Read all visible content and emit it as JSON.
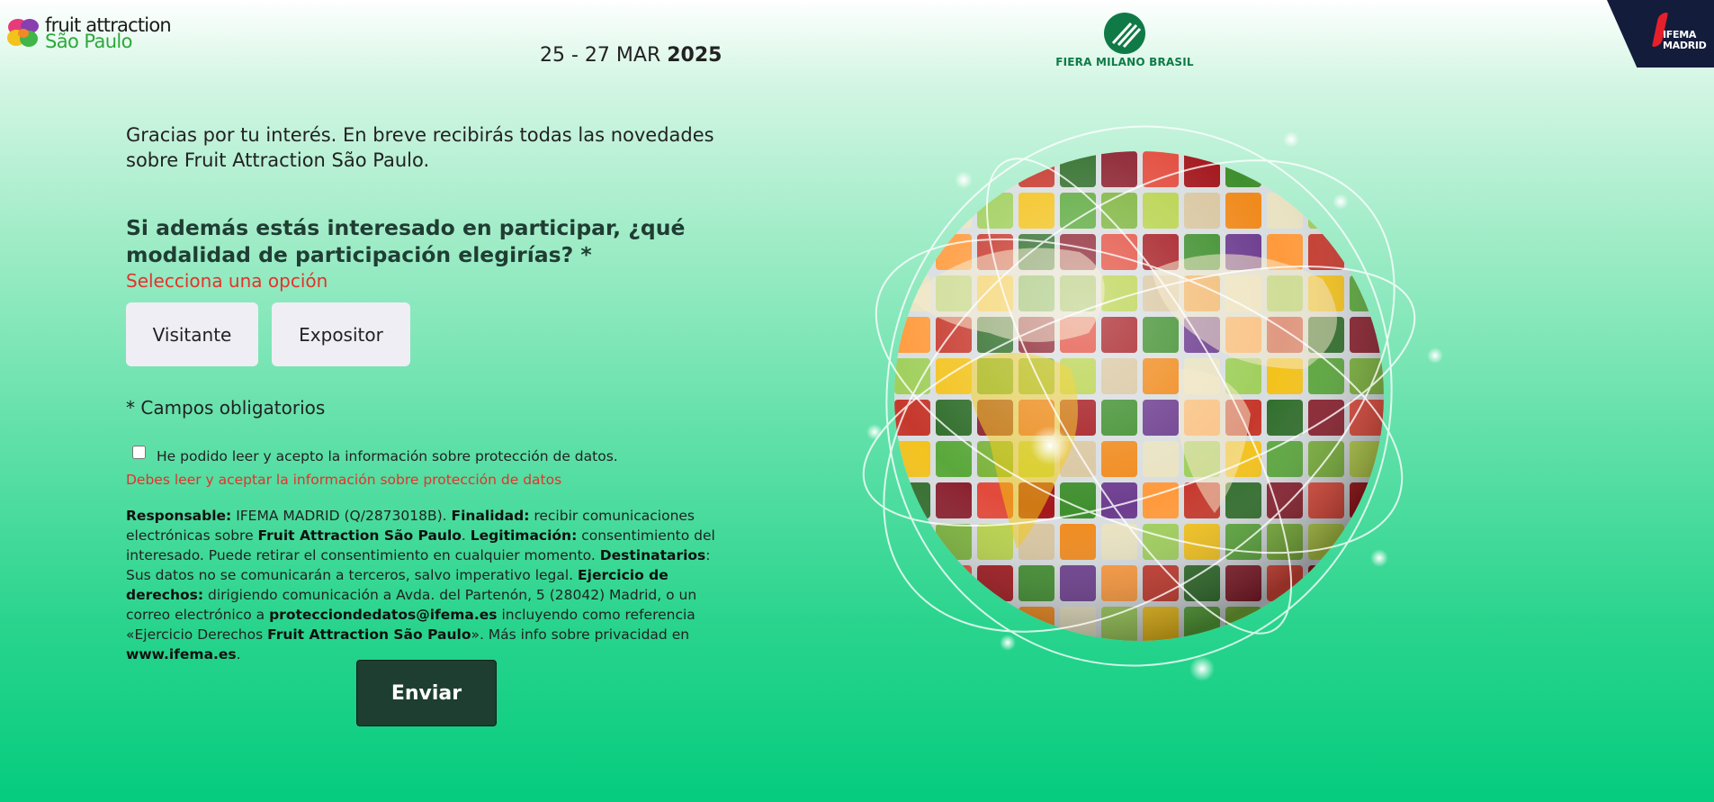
{
  "header": {
    "logo": {
      "line1": "fruit attraction",
      "line2": "São Paulo"
    },
    "date_range": "25 - 27 MAR",
    "date_year": "2025",
    "partner_logo": "FIERA MILANO BRASIL",
    "ifema_logo": {
      "line1": "IFEMA",
      "line2": "MADRID"
    }
  },
  "form": {
    "intro": "Gracias por tu interés. En breve recibirás todas las novedades sobre Fruit Attraction São Paulo.",
    "question": "Si además estás interesado en participar, ¿qué modalidad de participación elegirías? *",
    "select_error": "Selecciona una opción",
    "options": [
      "Visitante",
      "Expositor"
    ],
    "required_note": "* Campos obligatorios",
    "consent_label": "He podido leer y acepto la información sobre protección de datos.",
    "consent_error": "Debes leer y aceptar la información sobre protección de datos",
    "legal": {
      "p1": "Responsable:",
      "p2": " IFEMA MADRID (Q/2873018B). ",
      "p3": "Finalidad:",
      "p4": " recibir comunicaciones electrónicas sobre ",
      "p5": "Fruit Attraction São Paulo",
      "p6": ". ",
      "p7": "Legitimación:",
      "p8": " consentimiento del interesado. Puede retirar el consentimiento en cualquier momento. ",
      "p9": "Destinatarios",
      "p10": ": Sus datos no se comunicarán a terceros, salvo imperativo legal. ",
      "p11": "Ejercicio de derechos:",
      "p12": " dirigiendo comunicación a Avda. del Partenón, 5 (28042) Madrid, o un correo electrónico a ",
      "p13": "protecciondedatos@ifema.es",
      "p14": " incluyendo como referencia «Ejercicio Derechos ",
      "p15": "Fruit Attraction São Paulo",
      "p16": "». Más info sobre privacidad en ",
      "p17": "www.ifema.es",
      "p18": "."
    },
    "submit_label": "Enviar"
  },
  "colors": {
    "brand_dark_green": "#1d3e30",
    "error_red": "#e4322b",
    "fiera_green": "#0f7a46",
    "ifema_navy": "#141c3c"
  }
}
